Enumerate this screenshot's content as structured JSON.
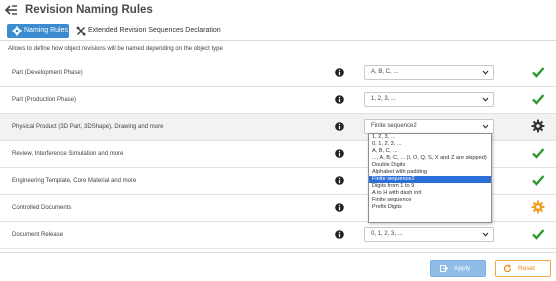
{
  "header": {
    "title": "Revision Naming Rules"
  },
  "tabs": {
    "naming_rules": "Naming Rules",
    "extended": "Extended Revision Sequences Declaration"
  },
  "description": "Allows to define how object revisions will be named depending on the object type",
  "rows": [
    {
      "label": "Part (Development Phase)",
      "value": "A, B, C, ...",
      "status": "check"
    },
    {
      "label": "Part (Production Phase)",
      "value": "1, 2, 3, ...",
      "status": "check"
    },
    {
      "label": "Physical Product (3D Part, 3DShape), Drawing and more",
      "value": "Finite sequence2",
      "status": "gear"
    },
    {
      "label": "Review, Interference Simulation and more",
      "value": "",
      "status": "check"
    },
    {
      "label": "Engineering Template, Core Material and more",
      "value": "",
      "status": "check"
    },
    {
      "label": "Controlled Documents",
      "value": "",
      "status": "gear-warning"
    },
    {
      "label": "Document Release",
      "value": "0, 1, 2, 3, ...",
      "status": "check"
    }
  ],
  "dropdown_options": [
    "1, 2, 3, ...",
    "0, 1, 2, 3, ...",
    "A, B, C, ...",
    "..., A, B, C, ... (I, O, Q, S, X and Z are skipped)",
    "Double Digits",
    "Alphabet with padding",
    "Finite sequence2",
    "Digits from 1 to 9",
    "A to H with dash init",
    "Finite sequence",
    "Prefix Digits"
  ],
  "dropdown_selected_index": 6,
  "footer": {
    "apply": "Apply",
    "reset": "Reset"
  },
  "colors": {
    "accent": "#3a8bd0",
    "check": "#2e9a2e",
    "warning": "#f0a020",
    "selected": "#2a6fd6"
  }
}
